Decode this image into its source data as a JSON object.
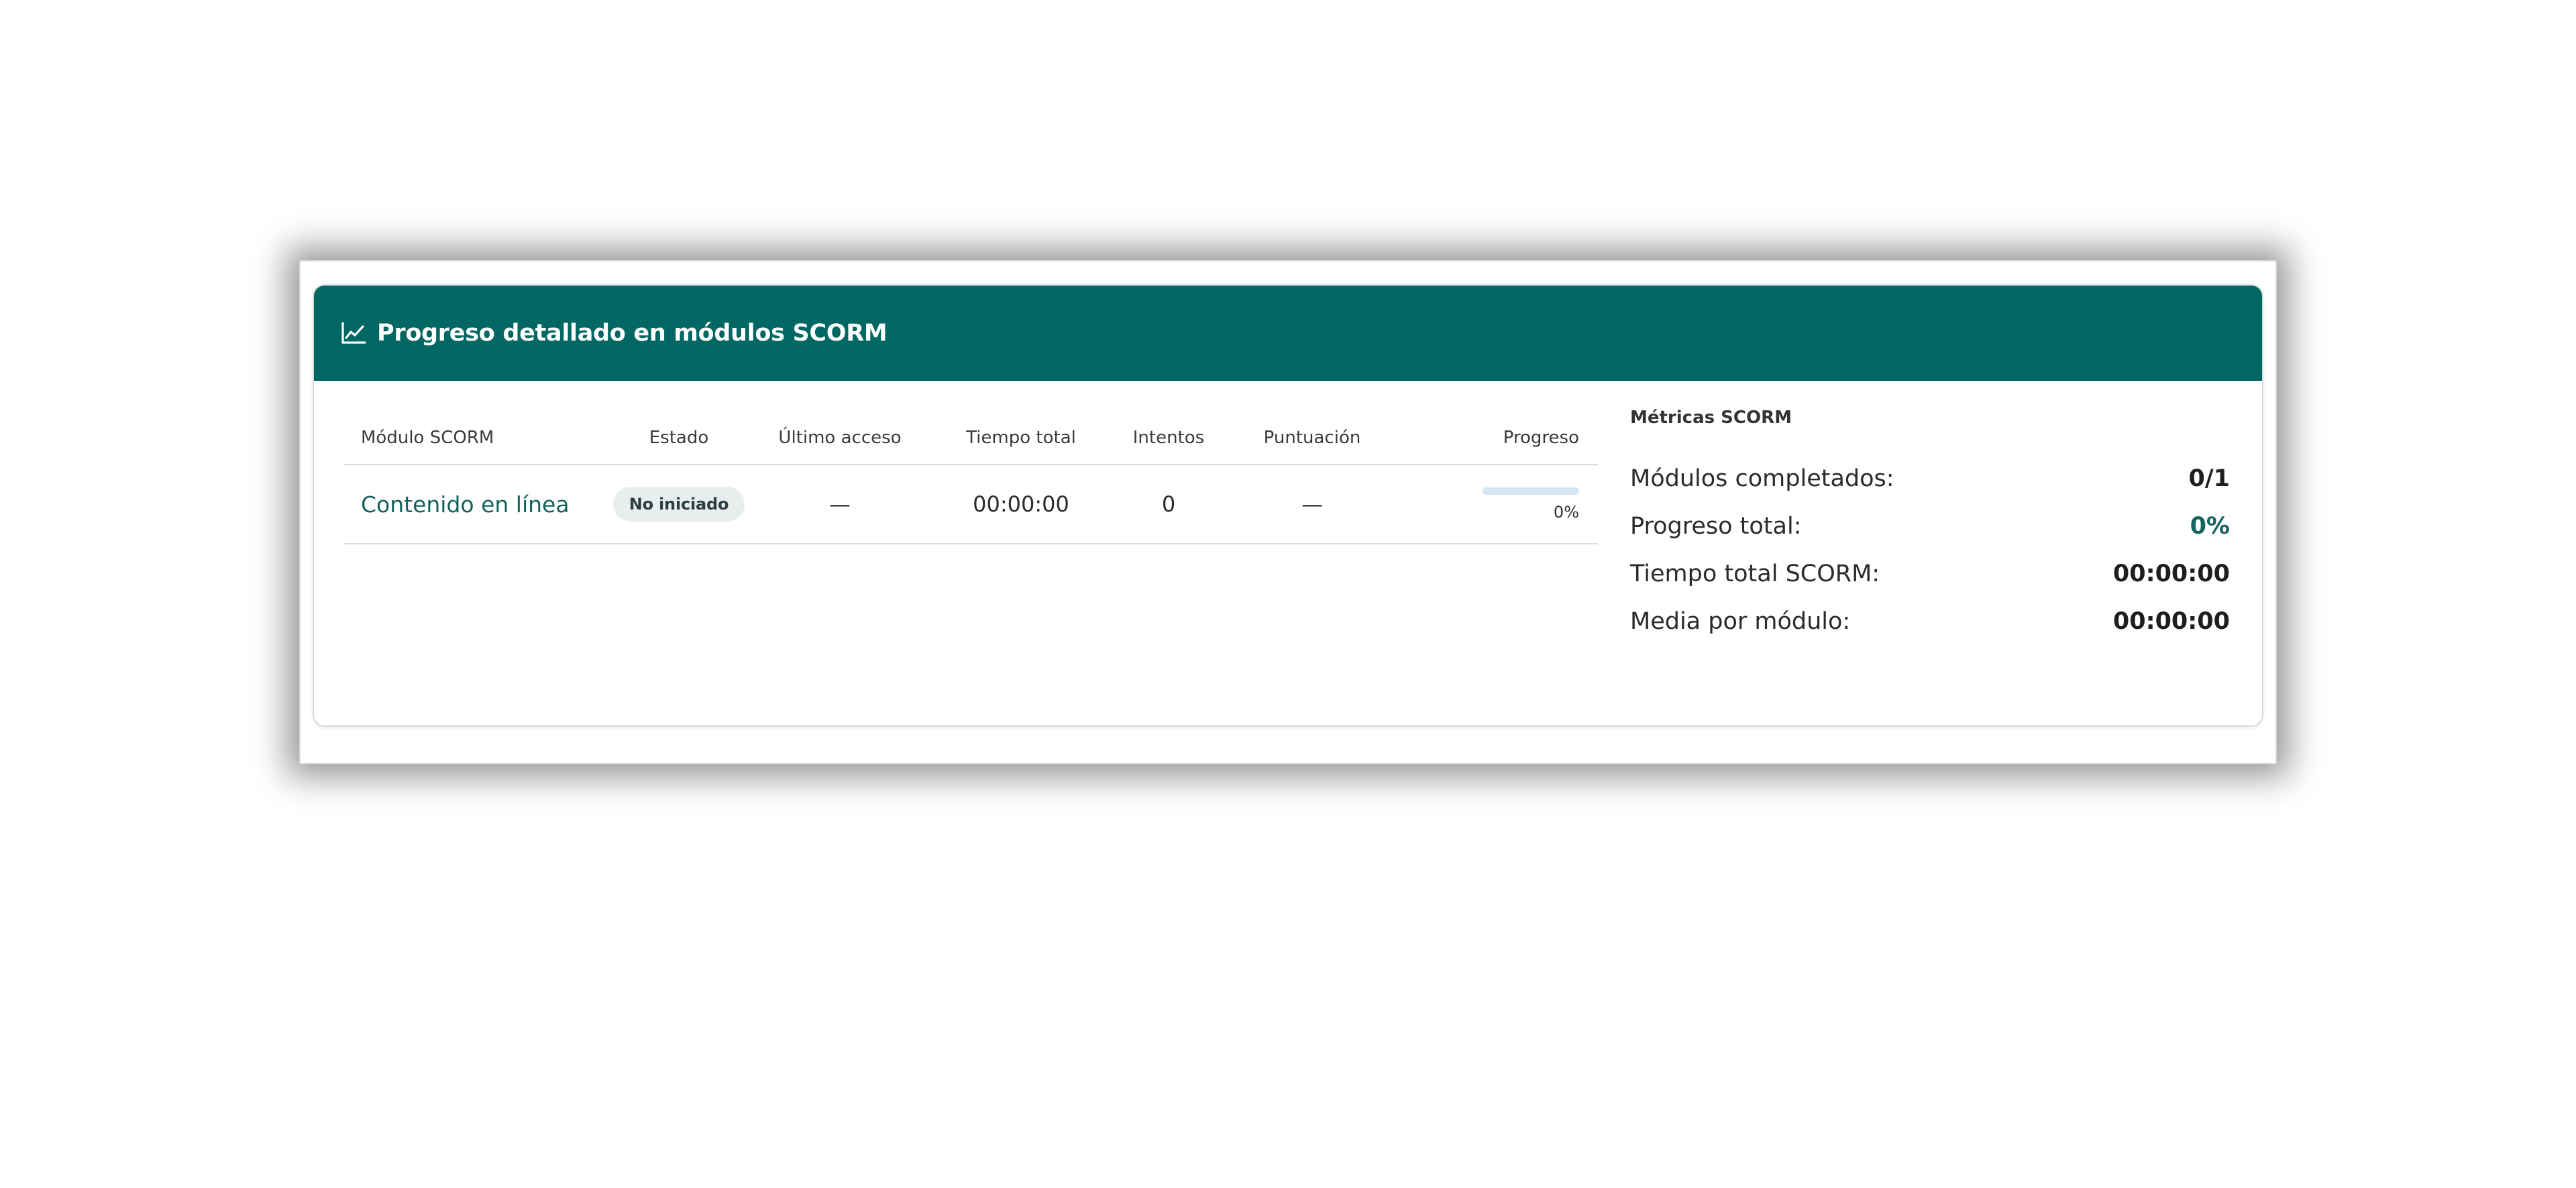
{
  "colors": {
    "header_bg": "#016762",
    "accent": "#16625d",
    "badge_bg": "#e8eeee",
    "progress_track": "#d4e7f1"
  },
  "card": {
    "icon": "line-chart-icon",
    "title": "Progreso detallado en módulos SCORM"
  },
  "table": {
    "headers": {
      "module": "Módulo SCORM",
      "status": "Estado",
      "last_access": "Último acceso",
      "total_time": "Tiempo total",
      "attempts": "Intentos",
      "score": "Puntuación",
      "progress": "Progreso"
    },
    "rows": [
      {
        "module": "Contenido en línea",
        "status": "No iniciado",
        "last_access": "—",
        "total_time": "00:00:00",
        "attempts": "0",
        "score": "—",
        "progress_value": 0,
        "progress_label": "0%"
      }
    ]
  },
  "metrics": {
    "title": "Métricas SCORM",
    "items": [
      {
        "label": "Módulos completados:",
        "value": "0/1"
      },
      {
        "label": "Progreso total:",
        "value": "0%"
      },
      {
        "label": "Tiempo total SCORM:",
        "value": "00:00:00"
      },
      {
        "label": "Media por módulo:",
        "value": "00:00:00"
      }
    ]
  }
}
